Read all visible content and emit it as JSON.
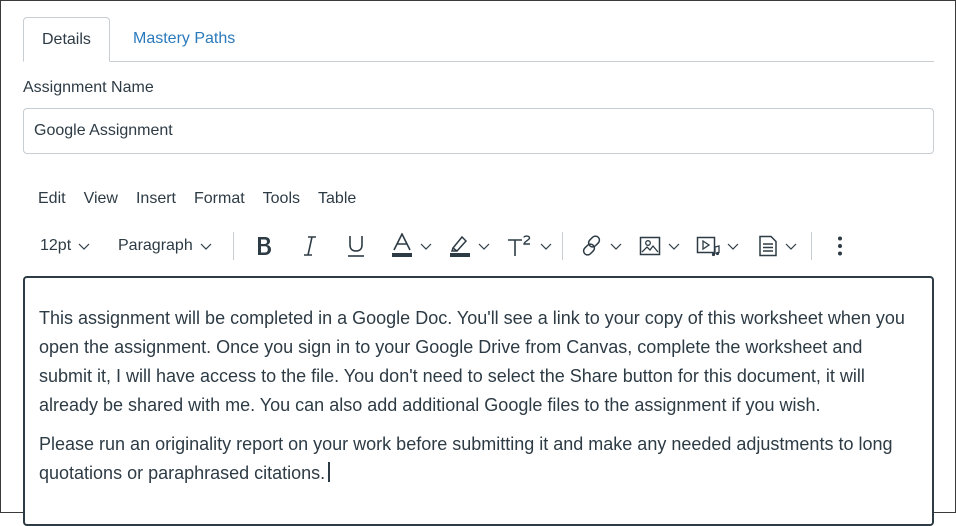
{
  "tabs": [
    {
      "label": "Details"
    },
    {
      "label": "Mastery Paths"
    }
  ],
  "assignment": {
    "label": "Assignment Name",
    "value": "Google Assignment"
  },
  "menubar": [
    "Edit",
    "View",
    "Insert",
    "Format",
    "Tools",
    "Table"
  ],
  "toolbar": {
    "font_size": "12pt",
    "block_format": "Paragraph",
    "icons": [
      "bold-icon",
      "italic-icon",
      "underline-icon",
      "text-color-icon",
      "highlight-icon",
      "superscript-icon",
      "link-icon",
      "image-icon",
      "media-icon",
      "document-icon",
      "more-icon"
    ]
  },
  "editor": {
    "paragraphs": [
      "This assignment will be completed in a Google Doc. You'll see a link to your copy of this worksheet when you open the assignment. Once you sign in to your Google Drive from Canvas, complete the worksheet and submit it, I will have access to the file. You don't need to select the Share button for this document, it will already be shared with me. You can also add additional Google files to the assignment if you wish.",
      "Please run an originality report on your work before submitting it and make any needed adjustments to long quotations or paraphrased citations."
    ]
  },
  "colors": {
    "text": "#2d3b45",
    "link": "#2b7abc",
    "border": "#c7cdd1"
  }
}
